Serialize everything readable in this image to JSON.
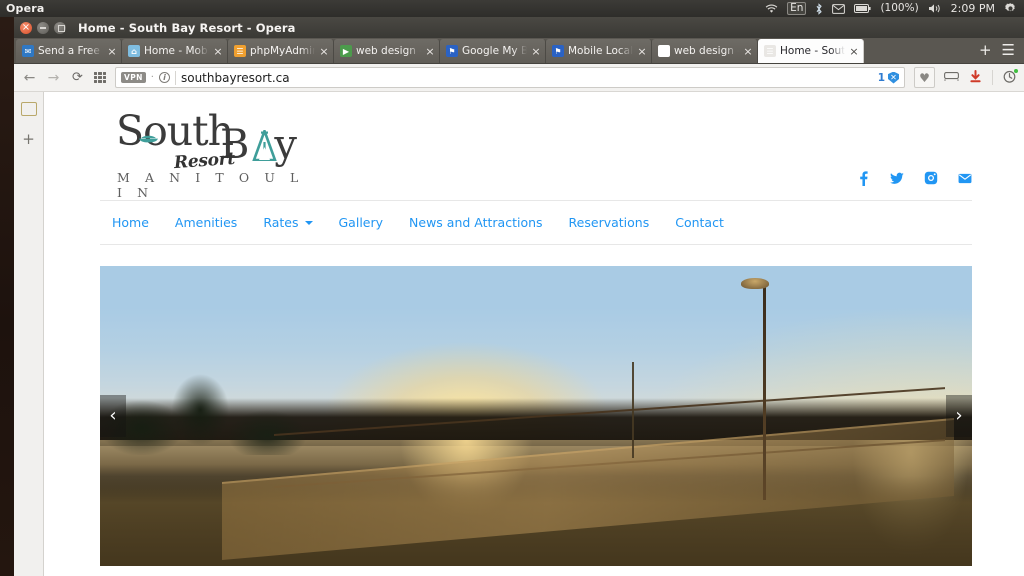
{
  "desktop": {
    "app_name": "Opera",
    "tray": {
      "wifi_icon": "wifi-icon",
      "keyboard_layout": "En",
      "bluetooth_icon": "bluetooth-icon",
      "mail_icon": "mail-icon",
      "battery_icon": "battery-icon",
      "battery_label": "(100%)",
      "volume_icon": "volume-icon",
      "clock": "2:09 PM",
      "settings_icon": "gear-icon"
    }
  },
  "window": {
    "title": "Home - South Bay Resort - Opera",
    "controls": {
      "close": "close-button",
      "minimize": "minimize-button",
      "maximize": "maximize-button"
    }
  },
  "tabs": [
    {
      "label": "Send a Free Fax",
      "favicon": "fax-icon",
      "favicon_class": "fi-fax",
      "glyph": "✉",
      "active": false
    },
    {
      "label": "Home - Mobile L",
      "favicon": "mobile-local-icon",
      "favicon_class": "fi-mob",
      "glyph": "⌂",
      "active": false
    },
    {
      "label": "phpMyAdmin",
      "favicon": "phpmyadmin-icon",
      "favicon_class": "fi-php",
      "glyph": "☰",
      "active": false
    },
    {
      "label": "web design - Go",
      "favicon": "google-maps-icon",
      "favicon_class": "fi-web",
      "glyph": "▶",
      "active": false
    },
    {
      "label": "Google My Busi",
      "favicon": "google-my-business-icon",
      "favicon_class": "fi-gmb",
      "glyph": "⚑",
      "active": false
    },
    {
      "label": "Mobile Local Co",
      "favicon": "google-my-business-icon",
      "favicon_class": "fi-mlc",
      "glyph": "⚑",
      "active": false
    },
    {
      "label": "web design - Go",
      "favicon": "google-icon",
      "favicon_class": "fi-goog",
      "glyph": "G",
      "active": false
    },
    {
      "label": "Home - South B",
      "favicon": "page-icon",
      "favicon_class": "fi-page",
      "glyph": "☰",
      "active": true
    }
  ],
  "tabbar": {
    "close_glyph": "×",
    "new_tab_glyph": "+",
    "tab_menu_glyph": "☰"
  },
  "toolbar": {
    "back_glyph": "←",
    "forward_glyph": "→",
    "reload_glyph": "⟳",
    "speeddial_icon": "speed-dial-icon",
    "vpn_badge": "VPN",
    "separator_dot": "·",
    "info_glyph": "i",
    "url": "southbayresort.ca",
    "blocked_count": "1",
    "shield_glyph": "✕",
    "heart_glyph": "♥",
    "sidebar_icon": "messenger-icon",
    "download_icon": "download-icon",
    "download_glyph": "⬇",
    "history_icon": "history-icon",
    "history_glyph": "◔"
  },
  "browser_sidebar": {
    "notes_icon": "notes-icon",
    "add_glyph": "+"
  },
  "site": {
    "logo": {
      "word_main": "South",
      "word_bay": "B",
      "word_bay_tail": "y",
      "script": "Resort",
      "subtitle": "M A N I T O U L I N",
      "boat_icon": "boat-icon",
      "teepee_icon": "teepee-icon",
      "accent_color": "#3f9e9a",
      "text_color": "#3b3b3b"
    },
    "social": [
      {
        "name": "facebook-icon",
        "glyph": "f"
      },
      {
        "name": "twitter-icon",
        "glyph": "✈"
      },
      {
        "name": "instagram-icon",
        "glyph": "◉"
      },
      {
        "name": "email-icon",
        "glyph": "✉"
      }
    ],
    "nav": [
      {
        "label": "Home",
        "has_dropdown": false
      },
      {
        "label": "Amenities",
        "has_dropdown": false
      },
      {
        "label": "Rates",
        "has_dropdown": true
      },
      {
        "label": "Gallery",
        "has_dropdown": false
      },
      {
        "label": "News and Attractions",
        "has_dropdown": false
      },
      {
        "label": "Reservations",
        "has_dropdown": false
      },
      {
        "label": "Contact",
        "has_dropdown": false
      }
    ],
    "nav_link_color": "#2196f3",
    "hero": {
      "alt": "Sunset over the lake with dock and railing at South Bay Resort",
      "prev_glyph": "‹",
      "next_glyph": "›"
    }
  }
}
